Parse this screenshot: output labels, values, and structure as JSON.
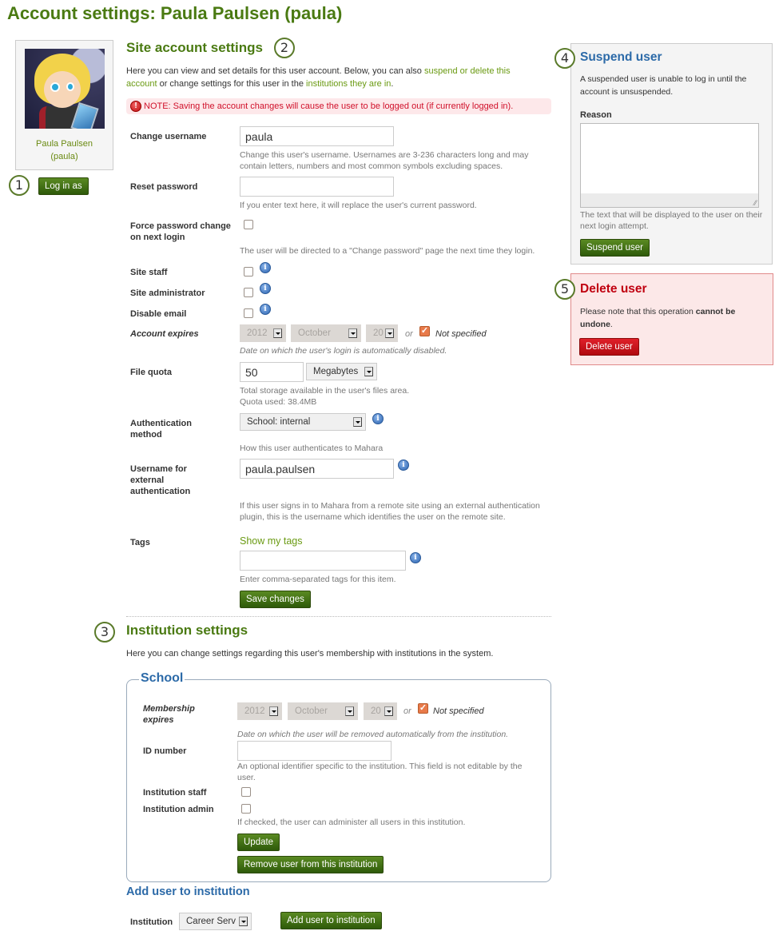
{
  "page": {
    "title": "Account settings: Paula Paulsen (paula)"
  },
  "callouts": [
    "1",
    "2",
    "3",
    "4",
    "5"
  ],
  "profile": {
    "name": "Paula Paulsen",
    "username": "(paula)",
    "login_as_label": "Log in as"
  },
  "site": {
    "title": "Site account settings",
    "intro_before": "Here you can view and set details for this user account. Below, you can also ",
    "intro_link1": "suspend or delete this account",
    "intro_middle": " or change settings for this user in the ",
    "intro_link2": "institutions they are in",
    "intro_after": ".",
    "note": "NOTE: Saving the account changes will cause the user to be logged out (if currently logged in).",
    "note_icon": "!",
    "fields": {
      "username": {
        "label": "Change username",
        "value": "paula",
        "desc": "Change this user's username. Usernames are 3-236 characters long and may contain letters, numbers and most common symbols excluding spaces."
      },
      "reset_password": {
        "label": "Reset password",
        "value": "",
        "desc": "If you enter text here, it will replace the user's current password."
      },
      "force_password": {
        "label": "Force password change on next login",
        "checked": false,
        "desc": "The user will be directed to a \"Change password\" page the next time they login."
      },
      "site_staff": {
        "label": "Site staff",
        "checked": false
      },
      "site_admin": {
        "label": "Site administrator",
        "checked": false
      },
      "disable_email": {
        "label": "Disable email",
        "checked": false
      },
      "account_expires": {
        "label": "Account expires",
        "year": "2012",
        "month": "October",
        "day": "20",
        "or": "or",
        "not_specified": "Not specified",
        "not_specified_checked": true,
        "desc": "Date on which the user's login is automatically disabled."
      },
      "file_quota": {
        "label": "File quota",
        "value": "50",
        "unit": "Megabytes",
        "desc": "Total storage available in the user's files area.",
        "used": "Quota used: 38.4MB"
      },
      "auth_method": {
        "label": "Authentication method",
        "value": "School: internal",
        "desc": "How this user authenticates to Mahara"
      },
      "external_username": {
        "label": "Username for external authentication",
        "value": "paula.paulsen",
        "desc": "If this user signs in to Mahara from a remote site using an external authentication plugin, this is the username which identifies the user on the remote site."
      },
      "tags": {
        "label": "Tags",
        "show_link": "Show my tags",
        "value": "",
        "desc": "Enter comma-separated tags for this item."
      }
    },
    "save_label": "Save changes"
  },
  "institution": {
    "title": "Institution settings",
    "intro": "Here you can change settings regarding this user's membership with institutions in the system.",
    "school": {
      "legend": "School",
      "membership_expires": {
        "label": "Membership expires",
        "year": "2012",
        "month": "October",
        "day": "20",
        "or": "or",
        "not_specified": "Not specified",
        "not_specified_checked": true,
        "desc": "Date on which the user will be removed automatically from the institution."
      },
      "id_number": {
        "label": "ID number",
        "value": "",
        "desc": "An optional identifier specific to the institution. This field is not editable by the user."
      },
      "inst_staff": {
        "label": "Institution staff",
        "checked": false
      },
      "inst_admin": {
        "label": "Institution admin",
        "checked": false,
        "desc": "If checked, the user can administer all users in this institution."
      },
      "update_label": "Update",
      "remove_label": "Remove user from this institution"
    },
    "add": {
      "title": "Add user to institution",
      "label": "Institution",
      "selected": "Career Serv",
      "button": "Add user to institution"
    }
  },
  "suspend": {
    "title": "Suspend user",
    "desc": "A suspended user is unable to log in until the account is unsuspended.",
    "reason_label": "Reason",
    "reason_value": "",
    "reason_desc": "The text that will be displayed to the user on their next login attempt.",
    "button": "Suspend user"
  },
  "delete": {
    "title": "Delete user",
    "desc_before": "Please note that this operation ",
    "desc_bold": "cannot be undone",
    "desc_after": ".",
    "button": "Delete user"
  },
  "colors": {
    "heading_green": "#4a7a12",
    "link_green": "#6a9a12",
    "blue_title": "#2c6aa8",
    "danger_red": "#c00010",
    "note_bg": "#fde8ea"
  }
}
